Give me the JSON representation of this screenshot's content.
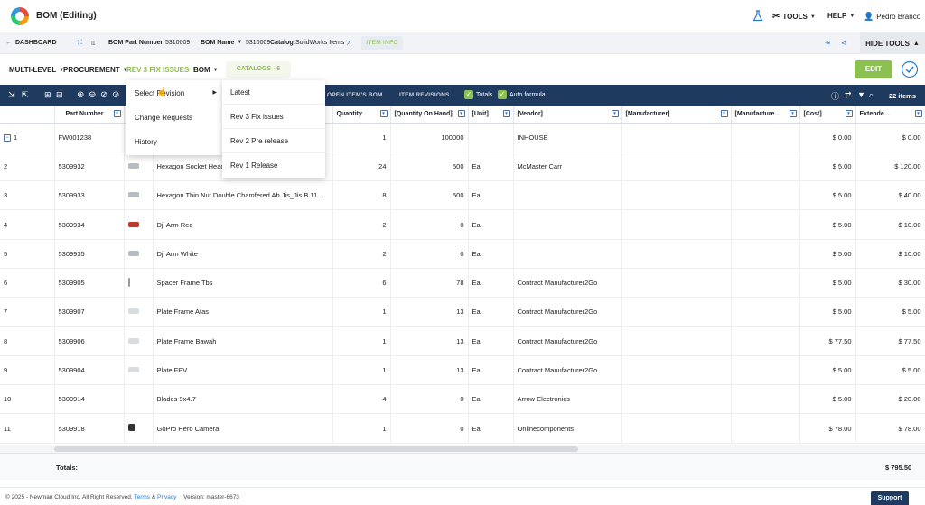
{
  "app": {
    "title": "BOM (Editing)"
  },
  "topnav": {
    "tools": "TOOLS",
    "help": "HELP",
    "user": "Pedro Branco"
  },
  "subbar": {
    "dashboard": "DASHBOARD",
    "bom_part_label": "BOM Part Number:",
    "bom_part_value": "5310009",
    "bom_name_label": "BOM Name",
    "bom_name_value": "5310009",
    "catalog_label": "Catalog:",
    "catalog_value": "SolidWorks Items",
    "item_info": "ITEM INFO",
    "hide_tools": "HIDE TOOLS"
  },
  "menubar": {
    "multi_level": "MULTI-LEVEL",
    "procurement": "PROCUREMENT",
    "revision": "REV 3 FIX ISSUES",
    "bom": "BOM",
    "catalogs": "CATALOGS - 6",
    "edit": "EDIT"
  },
  "toolbar": {
    "open_items_bom": "OPEN ITEM'S BOM",
    "item_revisions": "ITEM REVISIONS",
    "totals": "Totals",
    "auto_formula": "Auto formula",
    "items_count": "22 items"
  },
  "columns": [
    "",
    "Part Number",
    "",
    "",
    "Quantity",
    "[Quantity On Hand]",
    "[Unit]",
    "[Vendor]",
    "[Manufacturer]",
    "[Manufacture...",
    "[Cost]",
    "Extende..."
  ],
  "rows": [
    {
      "n": "1",
      "pn": "FW001238",
      "desc": "",
      "qty": "1",
      "qoh": "100000",
      "unit": "",
      "vendor": "INHOUSE",
      "cost": "$ 0.00",
      "ext": "$ 0.00",
      "thumb": "none"
    },
    {
      "n": "2",
      "pn": "5309932",
      "desc": "Hexagon Socket Head",
      "qty": "24",
      "qoh": "500",
      "unit": "Ea",
      "vendor": "McMaster Carr",
      "cost": "$ 5.00",
      "ext": "$ 120.00",
      "thumb": "grey"
    },
    {
      "n": "3",
      "pn": "5309933",
      "desc": "Hexagon Thin Nut Double Chamfered Ab Jis_Jis B 11...",
      "qty": "8",
      "qoh": "500",
      "unit": "Ea",
      "vendor": "",
      "cost": "$ 5.00",
      "ext": "$ 40.00",
      "thumb": "grey"
    },
    {
      "n": "4",
      "pn": "5309934",
      "desc": "Dji Arm Red",
      "qty": "2",
      "qoh": "0",
      "unit": "Ea",
      "vendor": "",
      "cost": "$ 5.00",
      "ext": "$ 10.00",
      "thumb": "red"
    },
    {
      "n": "5",
      "pn": "5309935",
      "desc": "Dji Arm White",
      "qty": "2",
      "qoh": "0",
      "unit": "Ea",
      "vendor": "",
      "cost": "$ 5.00",
      "ext": "$ 10.00",
      "thumb": "grey"
    },
    {
      "n": "6",
      "pn": "5309905",
      "desc": "Spacer Frame Tbs",
      "qty": "6",
      "qoh": "78",
      "unit": "Ea",
      "vendor": "Contract Manufacturer2Go",
      "cost": "$ 5.00",
      "ext": "$ 30.00",
      "thumb": "line"
    },
    {
      "n": "7",
      "pn": "5309907",
      "desc": "Plate Frame Atas",
      "qty": "1",
      "qoh": "13",
      "unit": "Ea",
      "vendor": "Contract Manufacturer2Go",
      "cost": "$ 5.00",
      "ext": "$ 5.00",
      "thumb": "light"
    },
    {
      "n": "8",
      "pn": "5309906",
      "desc": "Plate Frame Bawah",
      "qty": "1",
      "qoh": "13",
      "unit": "Ea",
      "vendor": "Contract Manufacturer2Go",
      "cost": "$ 77.50",
      "ext": "$ 77.50",
      "thumb": "light"
    },
    {
      "n": "9",
      "pn": "5309904",
      "desc": "Plate FPV",
      "qty": "1",
      "qoh": "13",
      "unit": "Ea",
      "vendor": "Contract Manufacturer2Go",
      "cost": "$ 5.00",
      "ext": "$ 5.00",
      "thumb": "light"
    },
    {
      "n": "10",
      "pn": "5309914",
      "desc": "Blades 9x4.7",
      "qty": "4",
      "qoh": "0",
      "unit": "Ea",
      "vendor": "Arrow Electronics",
      "cost": "$ 5.00",
      "ext": "$ 20.00",
      "thumb": "none"
    },
    {
      "n": "11",
      "pn": "5309918",
      "desc": "GoPro Hero Camera",
      "qty": "1",
      "qoh": "0",
      "unit": "Ea",
      "vendor": "Onlinecomponents",
      "cost": "$ 78.00",
      "ext": "$ 78.00",
      "thumb": "dark"
    }
  ],
  "totals": {
    "label": "Totals:",
    "value": "$ 795.50"
  },
  "footer": {
    "copyright": "© 2025 - Newman Cloud Inc. All Right Reserved.",
    "terms": "Terms",
    "amp": "&",
    "privacy": "Privacy",
    "version": "Version: master-6673",
    "support": "Support"
  },
  "menu_revision": {
    "items": [
      "Select Revision",
      "Change Requests",
      "History"
    ],
    "submenu": [
      "Latest",
      "Rev 3 Fix issues",
      "Rev 2 Pre release",
      "Rev 1 Release"
    ]
  },
  "colors": {
    "navy": "#1f3a5f",
    "green": "#8cc152",
    "accent_green_text": "#8cbc45"
  }
}
